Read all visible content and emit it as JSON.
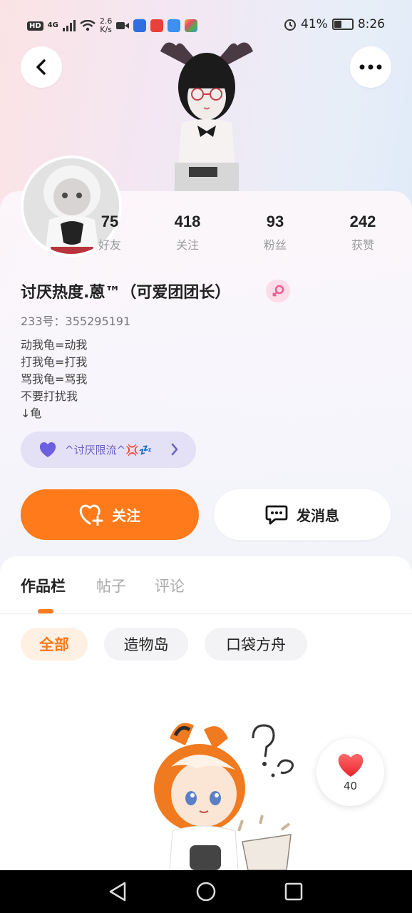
{
  "status_bar": {
    "hd": "HD",
    "network": "4G",
    "speed_value": "2.6",
    "speed_unit": "K/s",
    "battery": "41%",
    "battery_level": 0.41,
    "time": "8:26"
  },
  "profile": {
    "stats": [
      {
        "value": "75",
        "label": "好友"
      },
      {
        "value": "418",
        "label": "关注"
      },
      {
        "value": "93",
        "label": "粉丝"
      },
      {
        "value": "242",
        "label": "获赞"
      }
    ],
    "nickname": "讨厌热度.蒽™（可爱团团长）",
    "uid": "233号：355295191",
    "bio": [
      "动我龟=动我",
      "打我龟=打我",
      "骂我龟=骂我",
      "不要打扰我",
      "↓龟"
    ],
    "tag": "^讨厌限流^💢💤",
    "follow_label": "关注",
    "message_label": "发消息"
  },
  "tabs": [
    {
      "label": "作品栏",
      "active": true
    },
    {
      "label": "帖子",
      "active": false
    },
    {
      "label": "评论",
      "active": false
    }
  ],
  "filters": [
    {
      "label": "全部",
      "active": true
    },
    {
      "label": "造物岛",
      "active": false
    },
    {
      "label": "口袋方舟",
      "active": false
    }
  ],
  "like_bubble": {
    "count": "40"
  },
  "colors": {
    "accent": "#ff7a1a",
    "tag_text": "#6b62c6",
    "gender": "#f05a8c"
  }
}
